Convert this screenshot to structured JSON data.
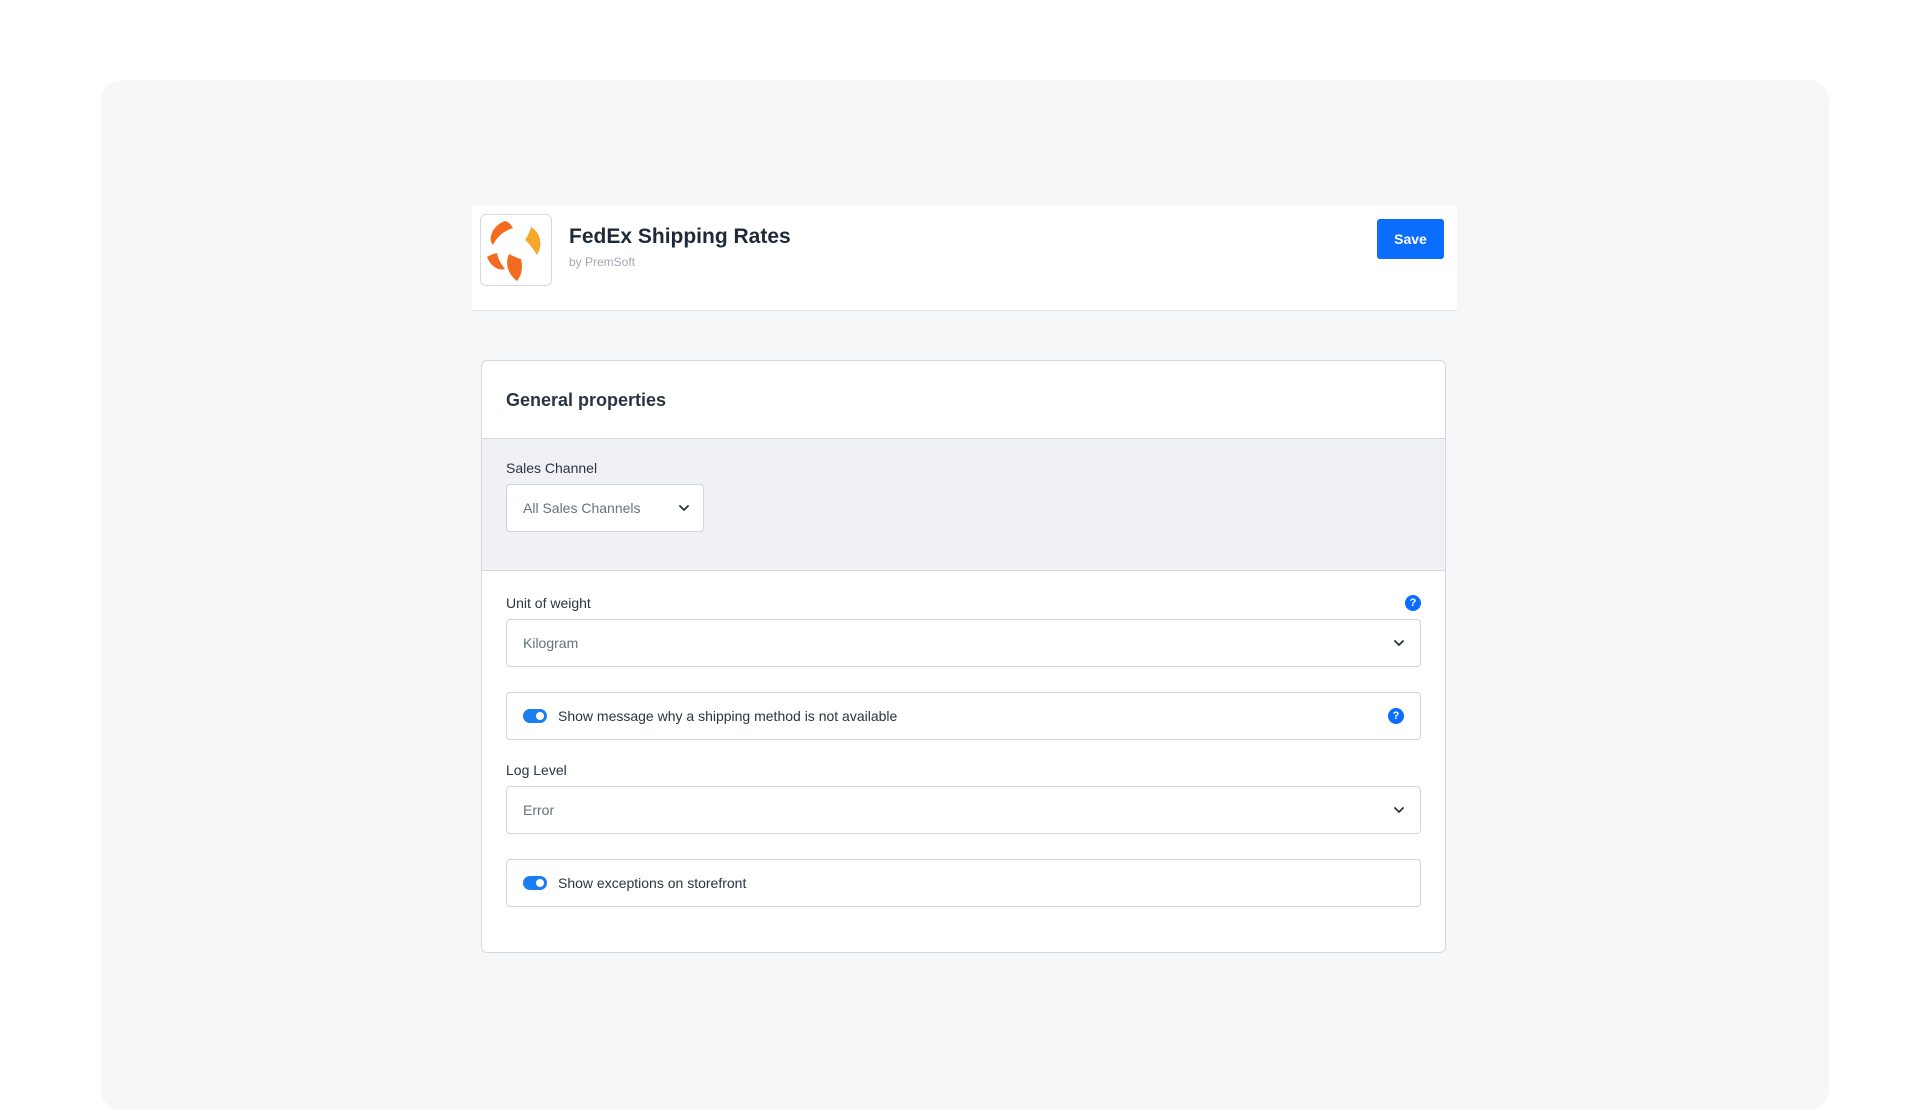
{
  "app": {
    "title": "FedEx Shipping Rates",
    "vendor": "by PremSoft",
    "logo_icon": "fedex-app-logo",
    "save_label": "Save",
    "accent_color": "#0b6dfd"
  },
  "card": {
    "title": "General properties",
    "sales_channel": {
      "label": "Sales Channel",
      "value": "All Sales Channels"
    },
    "unit_of_weight": {
      "label": "Unit of weight",
      "value": "Kilogram",
      "help_icon": "?"
    },
    "show_unavailable_message": {
      "label": "Show message why a shipping method is not available",
      "enabled": true,
      "help_icon": "?"
    },
    "log_level": {
      "label": "Log Level",
      "value": "Error"
    },
    "show_exceptions": {
      "label": "Show exceptions on storefront",
      "enabled": true
    }
  }
}
